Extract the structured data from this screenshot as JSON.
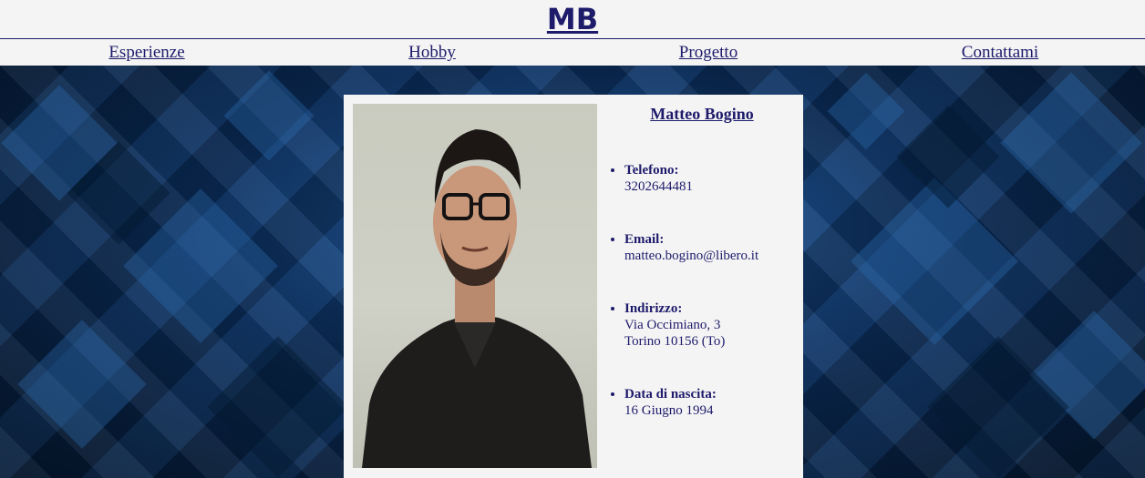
{
  "header": {
    "logo": "MB"
  },
  "nav": {
    "items": [
      {
        "label": "Esperienze"
      },
      {
        "label": "Hobby"
      },
      {
        "label": "Progetto"
      },
      {
        "label": "Contattami"
      }
    ]
  },
  "profile": {
    "name": "Matteo Bogino",
    "photo_alt": "Foto di Matteo Bogino",
    "details": [
      {
        "label": "Telefono:",
        "lines": [
          "3202644481"
        ]
      },
      {
        "label": "Email:",
        "lines": [
          "matteo.bogino@libero.it"
        ]
      },
      {
        "label": "Indirizzo:",
        "lines": [
          "Via Occimiano, 3",
          "Torino 10156 (To)"
        ]
      },
      {
        "label": "Data di nascita:",
        "lines": [
          "16 Giugno 1994"
        ]
      }
    ]
  },
  "colors": {
    "accent": "#1e1b6b",
    "background_light": "#f4f4f4",
    "background_dark": "#0c2f5c"
  }
}
